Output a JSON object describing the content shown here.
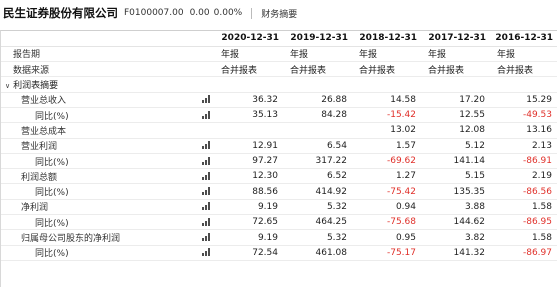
{
  "header": {
    "company": "民生证券股份有限公司",
    "code": "F0100007.00",
    "price": "0.00",
    "change_pct": "0.00%",
    "section": "财务摘要"
  },
  "columns": [
    "2020-12-31",
    "2019-12-31",
    "2018-12-31",
    "2017-12-31",
    "2016-12-31"
  ],
  "meta_rows": [
    {
      "label": "报告期",
      "values": [
        "年报",
        "年报",
        "年报",
        "年报",
        "年报"
      ]
    },
    {
      "label": "数据来源",
      "values": [
        "合并报表",
        "合并报表",
        "合并报表",
        "合并报表",
        "合并报表"
      ]
    }
  ],
  "group": {
    "label": "利润表摘要",
    "toggle": "∨"
  },
  "rows": [
    {
      "label": "营业总收入",
      "level": 2,
      "icon": true,
      "values": [
        "36.32",
        "26.88",
        "14.58",
        "17.20",
        "15.29"
      ]
    },
    {
      "label": "同比(%)",
      "level": 3,
      "icon": true,
      "values": [
        "35.13",
        "84.28",
        "-15.42",
        "12.55",
        "-49.53"
      ]
    },
    {
      "label": "营业总成本",
      "level": 2,
      "icon": false,
      "values": [
        "",
        "",
        "13.02",
        "12.08",
        "13.16"
      ]
    },
    {
      "label": "营业利润",
      "level": 2,
      "icon": true,
      "values": [
        "12.91",
        "6.54",
        "1.57",
        "5.12",
        "2.13"
      ]
    },
    {
      "label": "同比(%)",
      "level": 3,
      "icon": true,
      "values": [
        "97.27",
        "317.22",
        "-69.62",
        "141.14",
        "-86.91"
      ]
    },
    {
      "label": "利润总额",
      "level": 2,
      "icon": true,
      "values": [
        "12.30",
        "6.52",
        "1.27",
        "5.15",
        "2.19"
      ]
    },
    {
      "label": "同比(%)",
      "level": 3,
      "icon": true,
      "values": [
        "88.56",
        "414.92",
        "-75.42",
        "135.35",
        "-86.56"
      ]
    },
    {
      "label": "净利润",
      "level": 2,
      "icon": true,
      "values": [
        "9.19",
        "5.32",
        "0.94",
        "3.88",
        "1.58"
      ]
    },
    {
      "label": "同比(%)",
      "level": 3,
      "icon": true,
      "values": [
        "72.65",
        "464.25",
        "-75.68",
        "144.62",
        "-86.95"
      ]
    },
    {
      "label": "归属母公司股东的净利润",
      "level": 2,
      "icon": true,
      "values": [
        "9.19",
        "5.32",
        "0.95",
        "3.82",
        "1.58"
      ]
    },
    {
      "label": "同比(%)",
      "level": 3,
      "icon": true,
      "values": [
        "72.54",
        "461.08",
        "-75.17",
        "141.32",
        "-86.97"
      ]
    }
  ],
  "colors": {
    "negative": "#e0302a",
    "text": "#222222"
  }
}
